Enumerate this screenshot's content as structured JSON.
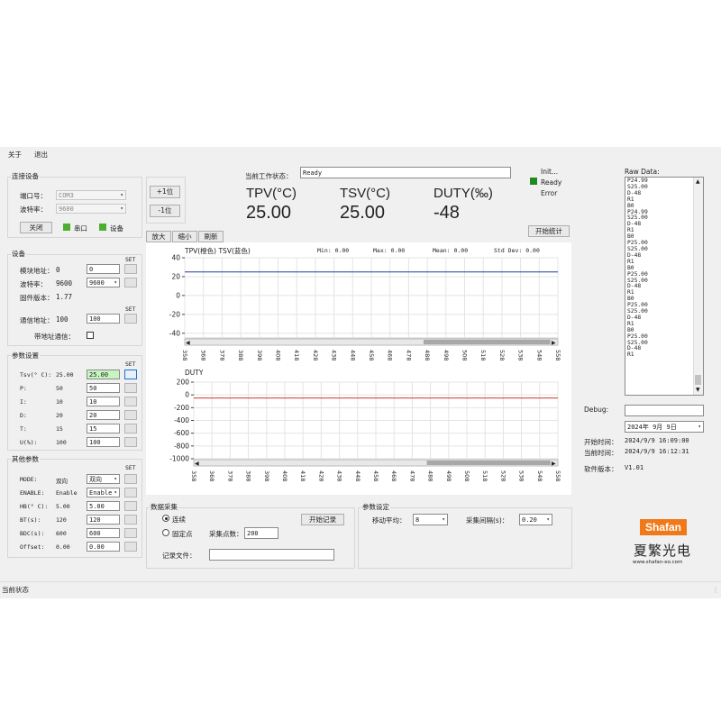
{
  "menu": {
    "about": "关于",
    "exit": "退出"
  },
  "connection": {
    "title": "连接设备",
    "port_label": "端口号：",
    "port_value": "COM3",
    "baud_label": "波特率：",
    "baud_value": "9600",
    "close_button": "关闭",
    "serial_indicator": "串口",
    "device_indicator": "设备"
  },
  "device": {
    "title": "设备",
    "set": "SET",
    "module_addr_label": "模块地址：",
    "module_addr_value": "0",
    "module_addr_input": "0",
    "baud_label": "波特率：",
    "baud_value": "9600",
    "baud_select": "9600",
    "fw_label": "固件版本：",
    "fw_value": "1.77",
    "comm_addr_label": "通信地址：",
    "comm_addr_value": "100",
    "comm_addr_input": "100",
    "with_addr_label": "带地址通信："
  },
  "params": {
    "title": "参数设置",
    "set": "SET",
    "rows": [
      {
        "label": "Tsv(° C):",
        "value": "25.00",
        "input": "25.00"
      },
      {
        "label": "P:",
        "value": "50",
        "input": "50"
      },
      {
        "label": "I:",
        "value": "10",
        "input": "10"
      },
      {
        "label": "D:",
        "value": "20",
        "input": "20"
      },
      {
        "label": "T:",
        "value": "15",
        "input": "15"
      },
      {
        "label": "U(%):",
        "value": "100",
        "input": "100"
      }
    ]
  },
  "other": {
    "title": "其他参数",
    "set": "SET",
    "rows": [
      {
        "label": "MODE:",
        "value": "双向",
        "input": "双向"
      },
      {
        "label": "ENABLE:",
        "value": "Enable",
        "input": "Enable"
      },
      {
        "label": "HB(° C):",
        "value": "5.00",
        "input": "5.00"
      },
      {
        "label": "BT(s):",
        "value": "120",
        "input": "120"
      },
      {
        "label": "BDC(s):",
        "value": "600",
        "input": "600"
      },
      {
        "label": "Offset:",
        "value": "0.00",
        "input": "0.00"
      }
    ]
  },
  "bit_buttons": {
    "plus": "+1位",
    "minus": "-1位"
  },
  "status": {
    "label": "当前工作状态：",
    "value": "Ready"
  },
  "readouts": {
    "tpv_label": "TPV(°C)",
    "tpv_value": "25.00",
    "tsv_label": "TSV(°C)",
    "tsv_value": "25.00",
    "duty_label": "DUTY(‰)",
    "duty_value": "-48"
  },
  "state_legend": {
    "init": "Init...",
    "ready": "Ready",
    "error": "Error"
  },
  "stats_button": "开始统计",
  "zoom": {
    "in": "放大",
    "out": "缩小",
    "refresh": "刷新"
  },
  "colors": {
    "accent_green": "#4caf2f",
    "tpv_line": "#ff8800",
    "tsv_line": "#1f3a9e",
    "duty_line": "#c83a2a",
    "brand_orange": "#f07a1a"
  },
  "chart_data": [
    {
      "type": "line",
      "title": "",
      "legend": "TPV(橙色)    TSV(蓝色)",
      "stats": {
        "min_label": "Min:",
        "min": "0.00",
        "max_label": "Max:",
        "max": "0.00",
        "mean_label": "Mean:",
        "mean": "0.00",
        "std_label": "Std Dev:",
        "std": "0.00"
      },
      "ylim": [
        -45,
        40
      ],
      "yticks": [
        40,
        20,
        0,
        -20,
        -40
      ],
      "xticks": [
        "358",
        "368",
        "378",
        "388",
        "398",
        "408",
        "418",
        "428",
        "438",
        "448",
        "458",
        "468",
        "478",
        "488",
        "498",
        "508",
        "518",
        "528",
        "538",
        "548",
        "558"
      ],
      "series": [
        {
          "name": "TSV(蓝色)",
          "x": [
            358,
            558
          ],
          "values": [
            25,
            25
          ]
        }
      ]
    },
    {
      "type": "line",
      "title": "",
      "legend": "DUTY",
      "ylim": [
        -1000,
        200
      ],
      "yticks": [
        200,
        0,
        -200,
        -400,
        -600,
        -800,
        -1000
      ],
      "xticks": [
        "358",
        "368",
        "378",
        "388",
        "398",
        "408",
        "418",
        "428",
        "438",
        "448",
        "458",
        "468",
        "478",
        "488",
        "498",
        "508",
        "518",
        "528",
        "538",
        "548",
        "558"
      ],
      "series": [
        {
          "name": "DUTY",
          "x": [
            358,
            558
          ],
          "values": [
            -48,
            -48
          ]
        }
      ]
    }
  ],
  "raw": {
    "label": "Raw Data:",
    "lines": [
      "P24.99",
      "S25.00",
      "D-48",
      "R1",
      "B0",
      "P24.99",
      "S25.00",
      "D-48",
      "R1",
      "B0",
      "P25.00",
      "S25.00",
      "D-48",
      "R1",
      "B0",
      "P25.00",
      "S25.00",
      "D-48",
      "R1",
      "B0",
      "P25.00",
      "S25.00",
      "D-48",
      "R1",
      "B0",
      "P25.00",
      "S25.00",
      "D-48",
      "R1"
    ]
  },
  "debug": {
    "label": "Debug:",
    "date_value": "2024年 9月 9日"
  },
  "times": {
    "start_label": "开始时间：",
    "start_value": "2024/9/9 16:09:00",
    "now_label": "当前时间：",
    "now_value": "2024/9/9 16:12:31",
    "ver_label": "软件版本：",
    "ver_value": "V1.01"
  },
  "acq": {
    "title": "数据采集",
    "continuous": "连续",
    "fixed": "固定点",
    "points_label": "采集点数：",
    "points_value": "200",
    "start_record": "开始记录",
    "file_label": "记录文件："
  },
  "paramset": {
    "title": "参数设定",
    "moving_avg_label": "移动平均：",
    "moving_avg_value": "8",
    "interval_label": "采集间隔(s)：",
    "interval_value": "0.20"
  },
  "brand": {
    "logo_text": "Shafan",
    "name": "夏繁光电",
    "url": "www.shafan-eo.com"
  },
  "statusbar": {
    "text": "当前状态"
  }
}
